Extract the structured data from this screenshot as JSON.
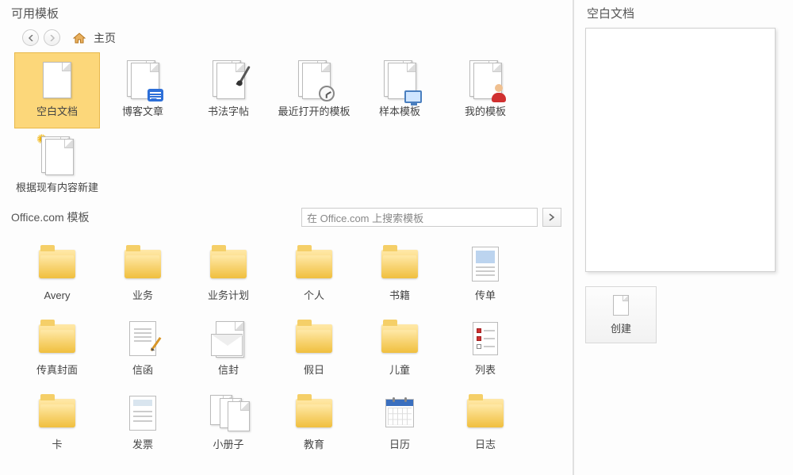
{
  "section_title": "可用模板",
  "breadcrumb": {
    "home_label": "主页"
  },
  "templates": [
    {
      "label": "空白文档",
      "selected": true,
      "icon": "blank"
    },
    {
      "label": "博客文章",
      "icon": "blog"
    },
    {
      "label": "书法字帖",
      "icon": "calligraphy"
    },
    {
      "label": "最近打开的模板",
      "icon": "recent"
    },
    {
      "label": "样本模板",
      "icon": "sample"
    },
    {
      "label": "我的模板",
      "icon": "my"
    },
    {
      "label": "根据现有内容新建",
      "icon": "from-existing"
    }
  ],
  "office_section": {
    "label": "Office.com 模板",
    "search_placeholder": "在 Office.com 上搜索模板"
  },
  "office_templates": [
    {
      "label": "Avery",
      "icon": "folder"
    },
    {
      "label": "业务",
      "icon": "folder"
    },
    {
      "label": "业务计划",
      "icon": "folder"
    },
    {
      "label": "个人",
      "icon": "folder"
    },
    {
      "label": "书籍",
      "icon": "folder"
    },
    {
      "label": "传单",
      "icon": "flyer"
    },
    {
      "label": "传真封面",
      "icon": "folder"
    },
    {
      "label": "信函",
      "icon": "letter"
    },
    {
      "label": "信封",
      "icon": "envelope"
    },
    {
      "label": "假日",
      "icon": "folder"
    },
    {
      "label": "儿童",
      "icon": "folder"
    },
    {
      "label": "列表",
      "icon": "checklist"
    },
    {
      "label": "卡",
      "icon": "folder"
    },
    {
      "label": "发票",
      "icon": "invoice"
    },
    {
      "label": "小册子",
      "icon": "booklet"
    },
    {
      "label": "教育",
      "icon": "folder"
    },
    {
      "label": "日历",
      "icon": "calendar"
    },
    {
      "label": "日志",
      "icon": "folder"
    }
  ],
  "preview": {
    "title": "空白文档",
    "create_label": "创建"
  }
}
